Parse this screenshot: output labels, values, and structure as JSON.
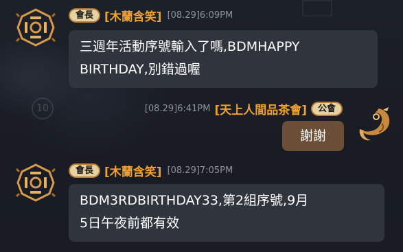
{
  "colors": {
    "name": "#f0a22e",
    "timestamp": "#8f939a",
    "bubble_other": "#2f343d",
    "bubble_self": "#6a4e35",
    "rank_tag_bg": "#e6d2a3",
    "rank_tag_border": "#b57e36"
  },
  "background": {
    "circle_number": "10"
  },
  "messages": [
    {
      "rank": "會長",
      "name": "[木蘭含笑]",
      "time": "[08.29]6:09PM",
      "text_line1": "三週年活動序號輸入了嗎,BDMHAPPY",
      "text_line2": "BIRTHDAY,別錯過喔",
      "avatar_icon": "guild-emblem-icon"
    },
    {
      "rank": "公會",
      "name": "[天上人間品茶會]",
      "time": "[08.29]6:41PM",
      "text": "謝謝",
      "avatar_icon": "dragon-emblem-icon"
    },
    {
      "rank": "會長",
      "name": "[木蘭含笑]",
      "time": "[08.29]7:05PM",
      "text_line1": "BDM3RDBIRTHDAY33,第2組序號,9月",
      "text_line2": "5日午夜前都有效",
      "avatar_icon": "guild-emblem-icon"
    }
  ]
}
